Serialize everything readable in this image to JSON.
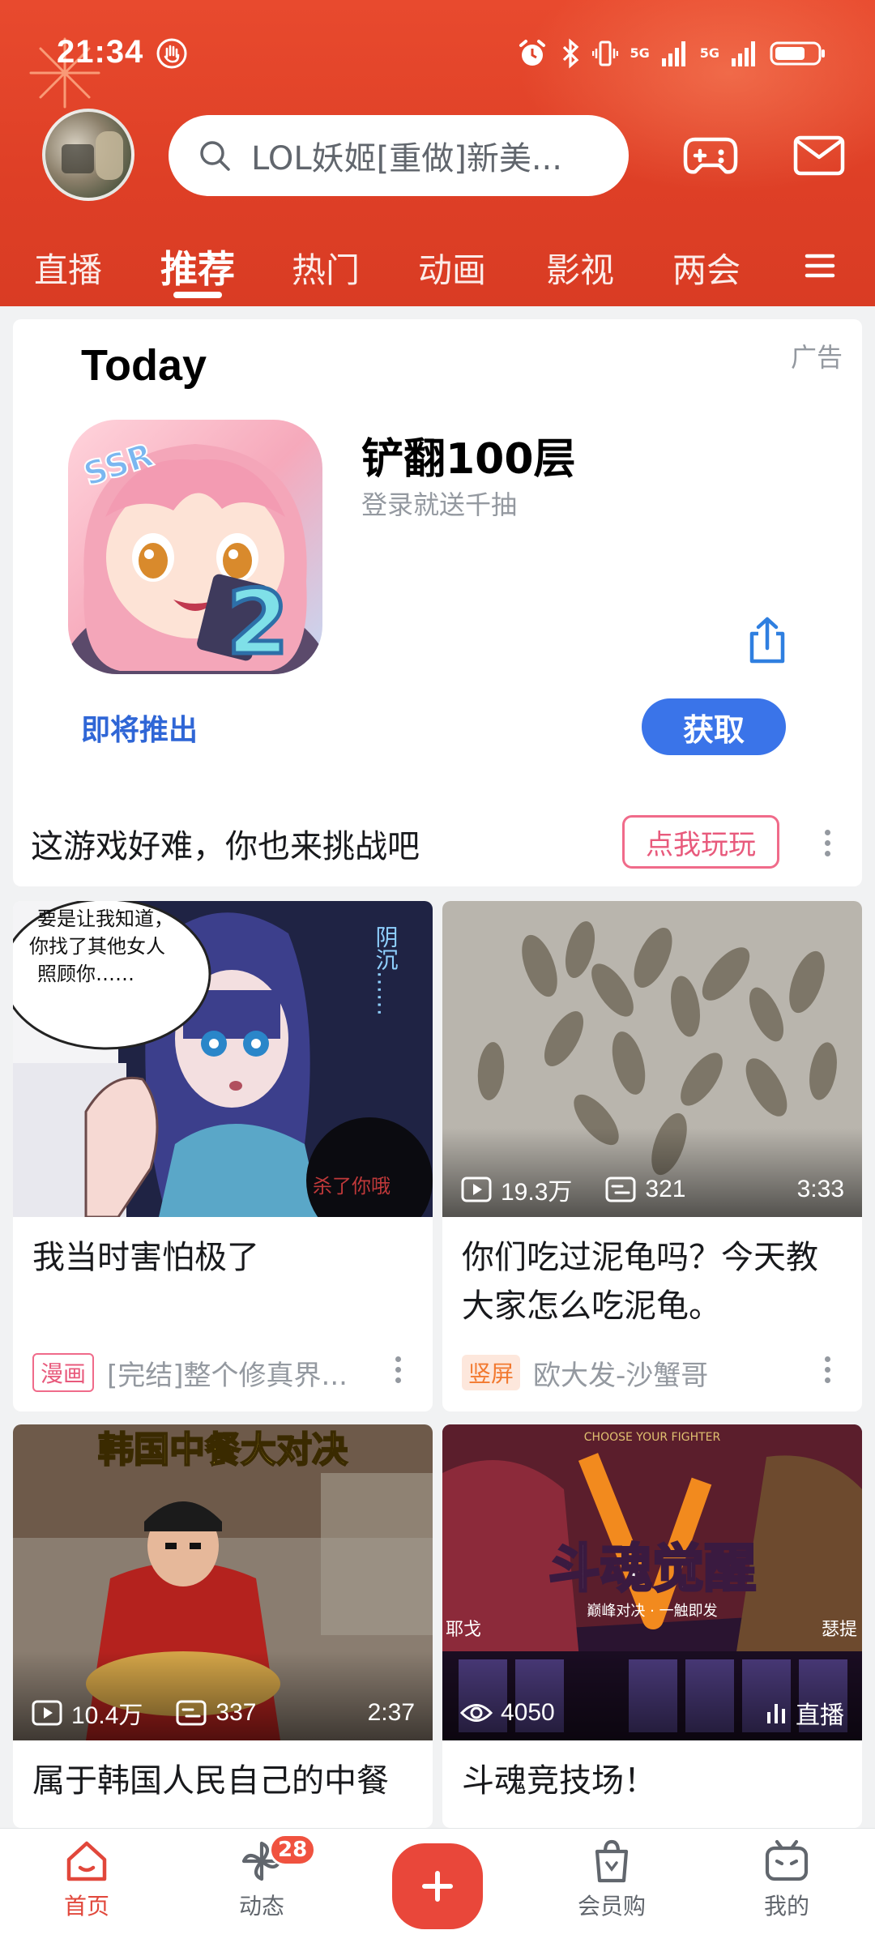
{
  "status_bar": {
    "time": "21:34",
    "network1": "5G",
    "network2": "5G"
  },
  "header": {
    "search_placeholder": "LOL妖姬[重做]新美...",
    "tabs": [
      "直播",
      "推荐",
      "热门",
      "动画",
      "影视",
      "两会"
    ],
    "active_tab": "推荐",
    "accent_color": "#e0442b"
  },
  "ad_card": {
    "heading": "Today",
    "ad_label": "广告",
    "app_name": "铲翻100层",
    "app_subtitle": "登录就送千抽",
    "coming_soon": "即将推出",
    "get_button": "获取",
    "tagline": "这游戏好难，你也来挑战吧",
    "play_button": "点我玩玩",
    "icon_badge": "SSR",
    "icon_number": "2"
  },
  "feed": [
    {
      "thumb_text_bubble": "要是让我知道，你找了其他女人照顾你……",
      "thumb_side_text": "阴沉……",
      "thumb_corner_text": "杀了你哦",
      "title": "我当时害怕极了",
      "badge": "漫画",
      "author": "[完结]整个修真界..."
    },
    {
      "views": "19.3万",
      "comments": "321",
      "duration": "3:33",
      "title": "你们吃过泥龟吗？今天教大家怎么吃泥龟。",
      "badge": "竖屏",
      "author": "欧大发-沙蟹哥"
    },
    {
      "thumb_banner": "韩国中餐大对决",
      "views": "10.4万",
      "comments": "337",
      "duration": "2:37",
      "title": "属于韩国人民自己的中餐"
    },
    {
      "thumb_top_text": "CHOOSE YOUR FIGHTER",
      "thumb_main_text": "斗魂觉醒",
      "thumb_sub_text": "巅峰对决 · 一触即发",
      "thumb_left_text": "耶戈",
      "thumb_right_text": "瑟提",
      "watching": "4050",
      "live_label": "直播",
      "title": "斗魂竞技场！"
    }
  ],
  "bottom_nav": {
    "items": [
      "首页",
      "动态",
      "会员购",
      "我的"
    ],
    "dynamic_badge": "28",
    "active": "首页"
  }
}
